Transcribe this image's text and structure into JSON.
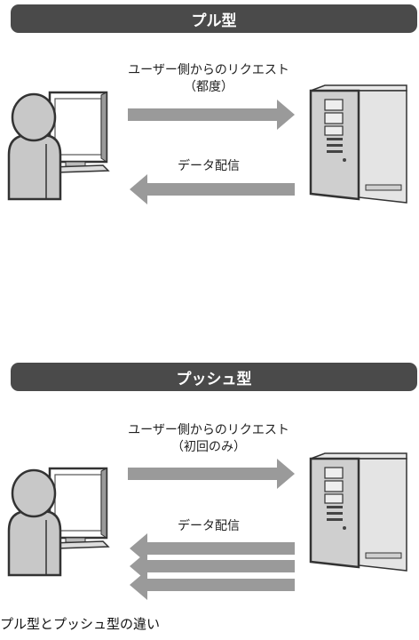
{
  "pull": {
    "title": "プル型",
    "request_label": "ユーザー側からのリクエスト",
    "request_note": "（都度）",
    "response_label": "データ配信"
  },
  "push": {
    "title": "プッシュ型",
    "request_label": "ユーザー側からのリクエスト",
    "request_note": "（初回のみ）",
    "response_label": "データ配信"
  },
  "caption": "プル型とプッシュ型の違い",
  "colors": {
    "banner": "#4a4a4a",
    "arrow": "#9a9a9a",
    "figure": "#c8c8c8",
    "server": "#d4d4d4"
  },
  "icons": [
    "user-at-computer-icon",
    "server-tower-icon",
    "arrow-right-icon",
    "arrow-left-icon"
  ]
}
